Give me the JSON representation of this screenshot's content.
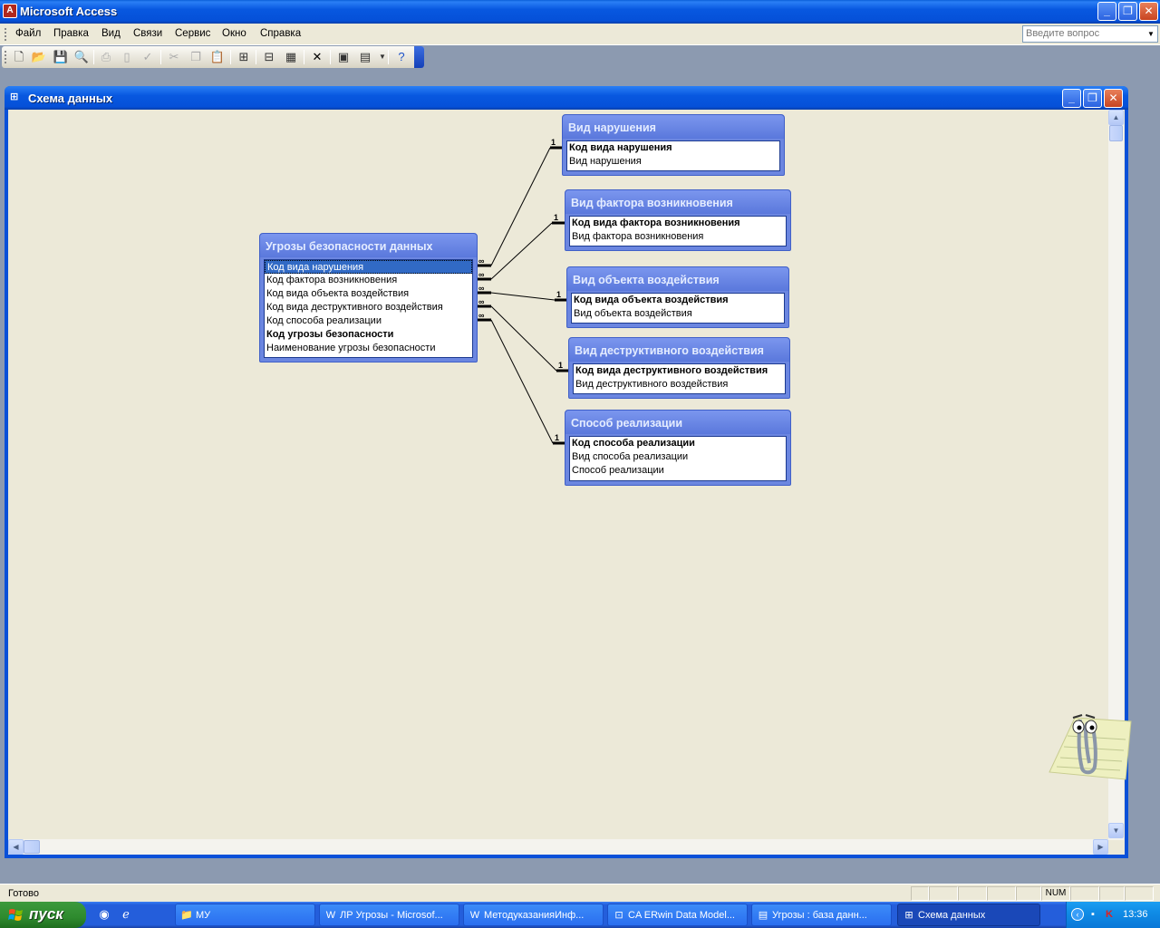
{
  "app": {
    "title": "Microsoft Access",
    "minimize": "_",
    "maximize": "❐",
    "close": "✕"
  },
  "menu": {
    "items": [
      "Файл",
      "Правка",
      "Вид",
      "Связи",
      "Сервис",
      "Окно",
      "Справка"
    ],
    "help_placeholder": "Введите вопрос"
  },
  "child_window": {
    "title": "Схема данных"
  },
  "tables": {
    "main": {
      "title": "Угрозы безопасности данных",
      "fields": [
        "Код вида нарушения",
        "Код фактора возникновения",
        "Код вида объекта воздействия",
        "Код вида деструктивного воздействия",
        "Код способа реализации",
        "Код угрозы безопасности",
        "Наименование угрозы безопасности"
      ]
    },
    "t1": {
      "title": "Вид нарушения",
      "fields": [
        "Код вида нарушения",
        "Вид нарушения"
      ]
    },
    "t2": {
      "title": "Вид фактора возникновения",
      "fields": [
        "Код вида фактора возникновения",
        "Вид фактора возникновения"
      ]
    },
    "t3": {
      "title": "Вид объекта воздействия",
      "fields": [
        "Код вида объекта воздействия",
        "Вид объекта воздействия"
      ]
    },
    "t4": {
      "title": "Вид деструктивного воздействия",
      "fields": [
        "Код вида деструктивного воздействия",
        "Вид деструктивного воздействия"
      ]
    },
    "t5": {
      "title": "Способ реализации",
      "fields": [
        "Код способа реализации",
        "Вид способа реализации",
        "Способ реализации"
      ]
    }
  },
  "relations": {
    "one": "1",
    "many": "∞"
  },
  "statusbar": {
    "text": "Готово",
    "num": "NUM"
  },
  "taskbar": {
    "start": "пуск",
    "tasks": [
      "МУ",
      "ЛР Угрозы - Microsof...",
      "МетодуказанияИнф...",
      "CA ERwin Data Model...",
      "Угрозы : база данн...",
      "Схема данных"
    ],
    "clock": "13:36"
  }
}
